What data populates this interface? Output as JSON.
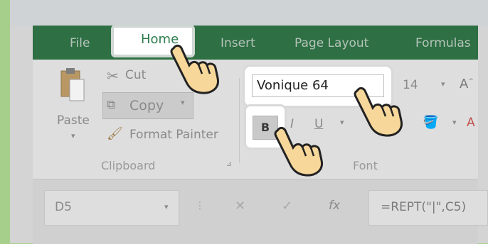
{
  "tabs": {
    "file": "File",
    "home": "Home",
    "insert": "Insert",
    "page_layout": "Page Layout",
    "formulas": "Formulas"
  },
  "clipboard": {
    "paste": "Paste",
    "cut": "Cut",
    "copy": "Copy",
    "format_painter": "Format Painter",
    "group": "Clipboard"
  },
  "font": {
    "name": "Vonique 64",
    "size": "14",
    "bold": "B",
    "italic": "I",
    "underline": "U",
    "group": "Font"
  },
  "formula_bar": {
    "cell_ref": "D5",
    "fx": "fx",
    "formula": "=REPT(\"|\",C5)"
  },
  "colors": {
    "accent_green": "#2e6f43",
    "home_text": "#2e7d4f"
  }
}
